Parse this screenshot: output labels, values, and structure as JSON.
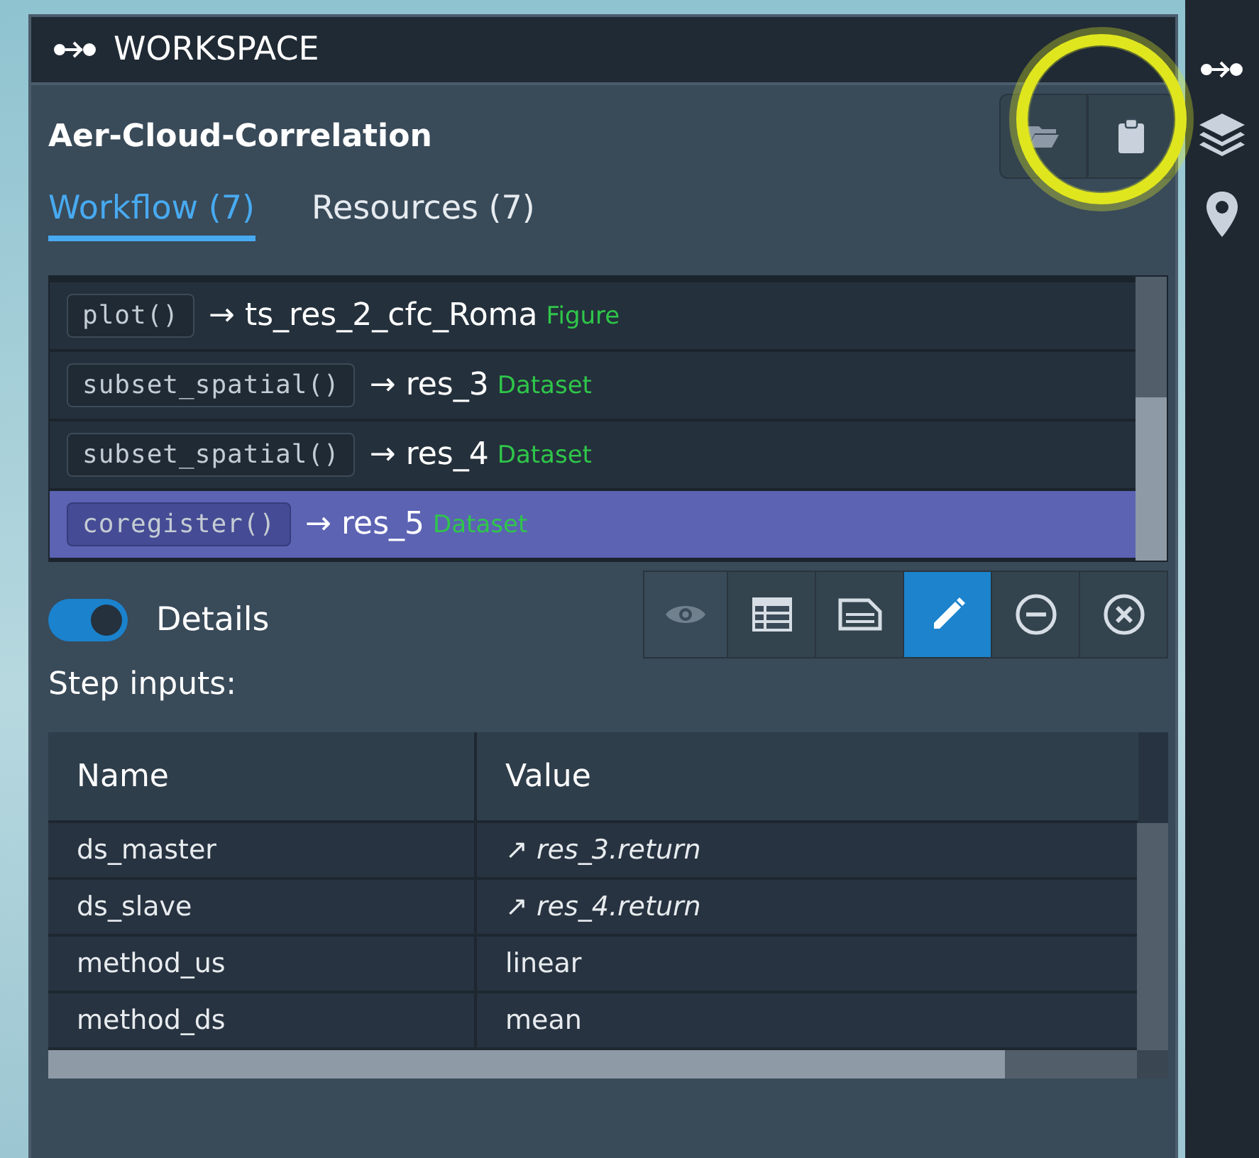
{
  "header": {
    "title": "WORKSPACE"
  },
  "workspace": {
    "name": "Aer-Cloud-Correlation"
  },
  "tabs": [
    {
      "label": "Workflow (7)",
      "selected": true
    },
    {
      "label": "Resources (7)",
      "selected": false
    }
  ],
  "steps": [
    {
      "call": "plot()",
      "arrow": "→",
      "result": "ts_res_2_cfc_Roma",
      "type": "Figure",
      "selected": false
    },
    {
      "call": "subset_spatial()",
      "arrow": "→",
      "result": "res_3",
      "type": "Dataset",
      "selected": false
    },
    {
      "call": "subset_spatial()",
      "arrow": "→",
      "result": "res_4",
      "type": "Dataset",
      "selected": false
    },
    {
      "call": "coregister()",
      "arrow": "→",
      "result": "res_5",
      "type": "Dataset",
      "selected": true
    }
  ],
  "step_actions": [
    {
      "kind": "eye",
      "active": false
    },
    {
      "kind": "table",
      "active": false
    },
    {
      "kind": "document",
      "active": false
    },
    {
      "kind": "pencil",
      "active": true
    },
    {
      "kind": "minus",
      "active": false
    },
    {
      "kind": "cross",
      "active": false
    }
  ],
  "details": {
    "label": "Details",
    "on": true
  },
  "step_inputs": {
    "label": "Step inputs:",
    "columns": [
      "Name",
      "Value"
    ],
    "rows": [
      {
        "name": "ds_master",
        "value": "↗ res_3.return",
        "kind": "reference"
      },
      {
        "name": "ds_slave",
        "value": "↗ res_4.return",
        "kind": "reference"
      },
      {
        "name": "method_us",
        "value": "linear",
        "kind": "plain"
      },
      {
        "name": "method_ds",
        "value": "mean",
        "kind": "plain"
      }
    ]
  }
}
